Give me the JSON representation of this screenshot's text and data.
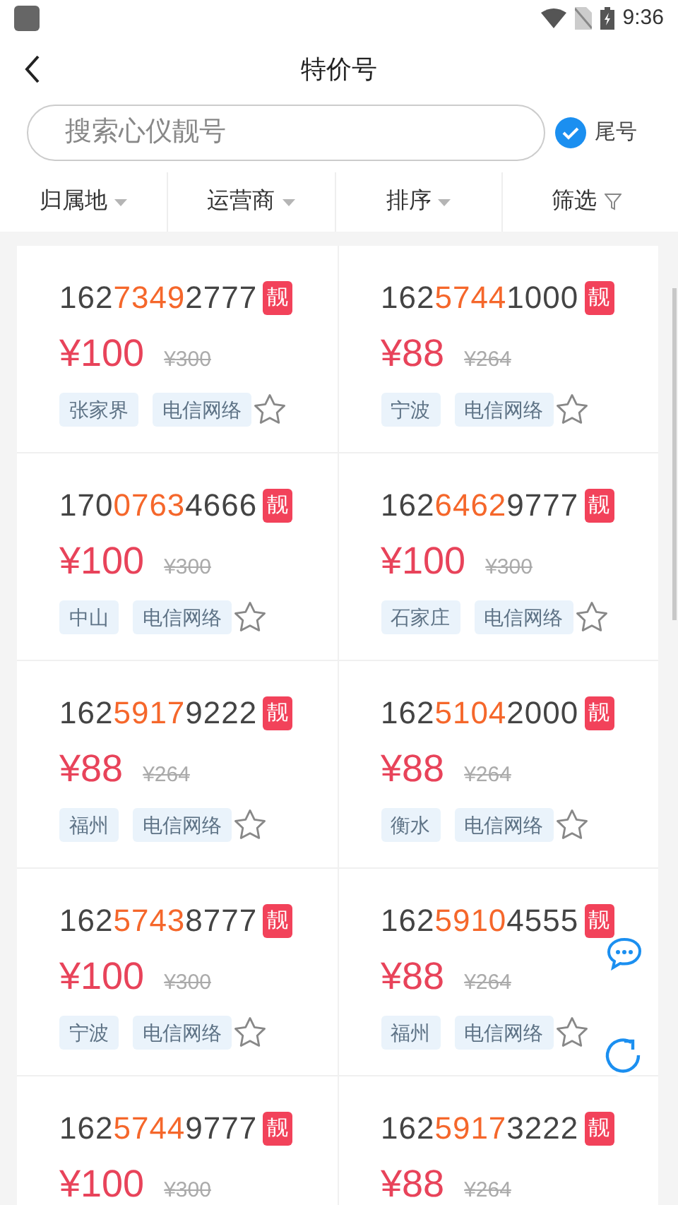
{
  "status_bar": {
    "time": "9:36"
  },
  "header": {
    "title": "特价号"
  },
  "search": {
    "placeholder": "搜索心仪靓号"
  },
  "tail_toggle": {
    "label": "尾号",
    "checked": true
  },
  "filters": [
    {
      "label": "归属地",
      "kind": "dropdown"
    },
    {
      "label": "运营商",
      "kind": "dropdown"
    },
    {
      "label": "排序",
      "kind": "dropdown"
    },
    {
      "label": "筛选",
      "kind": "filter"
    }
  ],
  "numbers": [
    {
      "number_parts": [
        "162",
        "7349",
        "2777"
      ],
      "badge": "靓",
      "price": "¥100",
      "original_price": "¥300",
      "tags": [
        "张家界",
        "电信网络"
      ],
      "favorited": false
    },
    {
      "number_parts": [
        "162",
        "5744",
        "1000"
      ],
      "badge": "靓",
      "price": "¥88",
      "original_price": "¥264",
      "tags": [
        "宁波",
        "电信网络"
      ],
      "favorited": false
    },
    {
      "number_parts": [
        "170",
        "0763",
        "4666"
      ],
      "badge": "靓",
      "price": "¥100",
      "original_price": "¥300",
      "tags": [
        "中山",
        "电信网络"
      ],
      "favorited": false
    },
    {
      "number_parts": [
        "162",
        "6462",
        "9777"
      ],
      "badge": "靓",
      "price": "¥100",
      "original_price": "¥300",
      "tags": [
        "石家庄",
        "电信网络"
      ],
      "favorited": false
    },
    {
      "number_parts": [
        "162",
        "5917",
        "9222"
      ],
      "badge": "靓",
      "price": "¥88",
      "original_price": "¥264",
      "tags": [
        "福州",
        "电信网络"
      ],
      "favorited": false
    },
    {
      "number_parts": [
        "162",
        "5104",
        "2000"
      ],
      "badge": "靓",
      "price": "¥88",
      "original_price": "¥264",
      "tags": [
        "衡水",
        "电信网络"
      ],
      "favorited": false
    },
    {
      "number_parts": [
        "162",
        "5743",
        "8777"
      ],
      "badge": "靓",
      "price": "¥100",
      "original_price": "¥300",
      "tags": [
        "宁波",
        "电信网络"
      ],
      "favorited": false
    },
    {
      "number_parts": [
        "162",
        "5910",
        "4555"
      ],
      "badge": "靓",
      "price": "¥88",
      "original_price": "¥264",
      "tags": [
        "福州",
        "电信网络"
      ],
      "favorited": false
    },
    {
      "number_parts": [
        "162",
        "5744",
        "9777"
      ],
      "badge": "靓",
      "price": "¥100",
      "original_price": "¥300"
    },
    {
      "number_parts": [
        "162",
        "5917",
        "3222"
      ],
      "badge": "靓",
      "price": "¥88",
      "original_price": "¥264"
    }
  ]
}
